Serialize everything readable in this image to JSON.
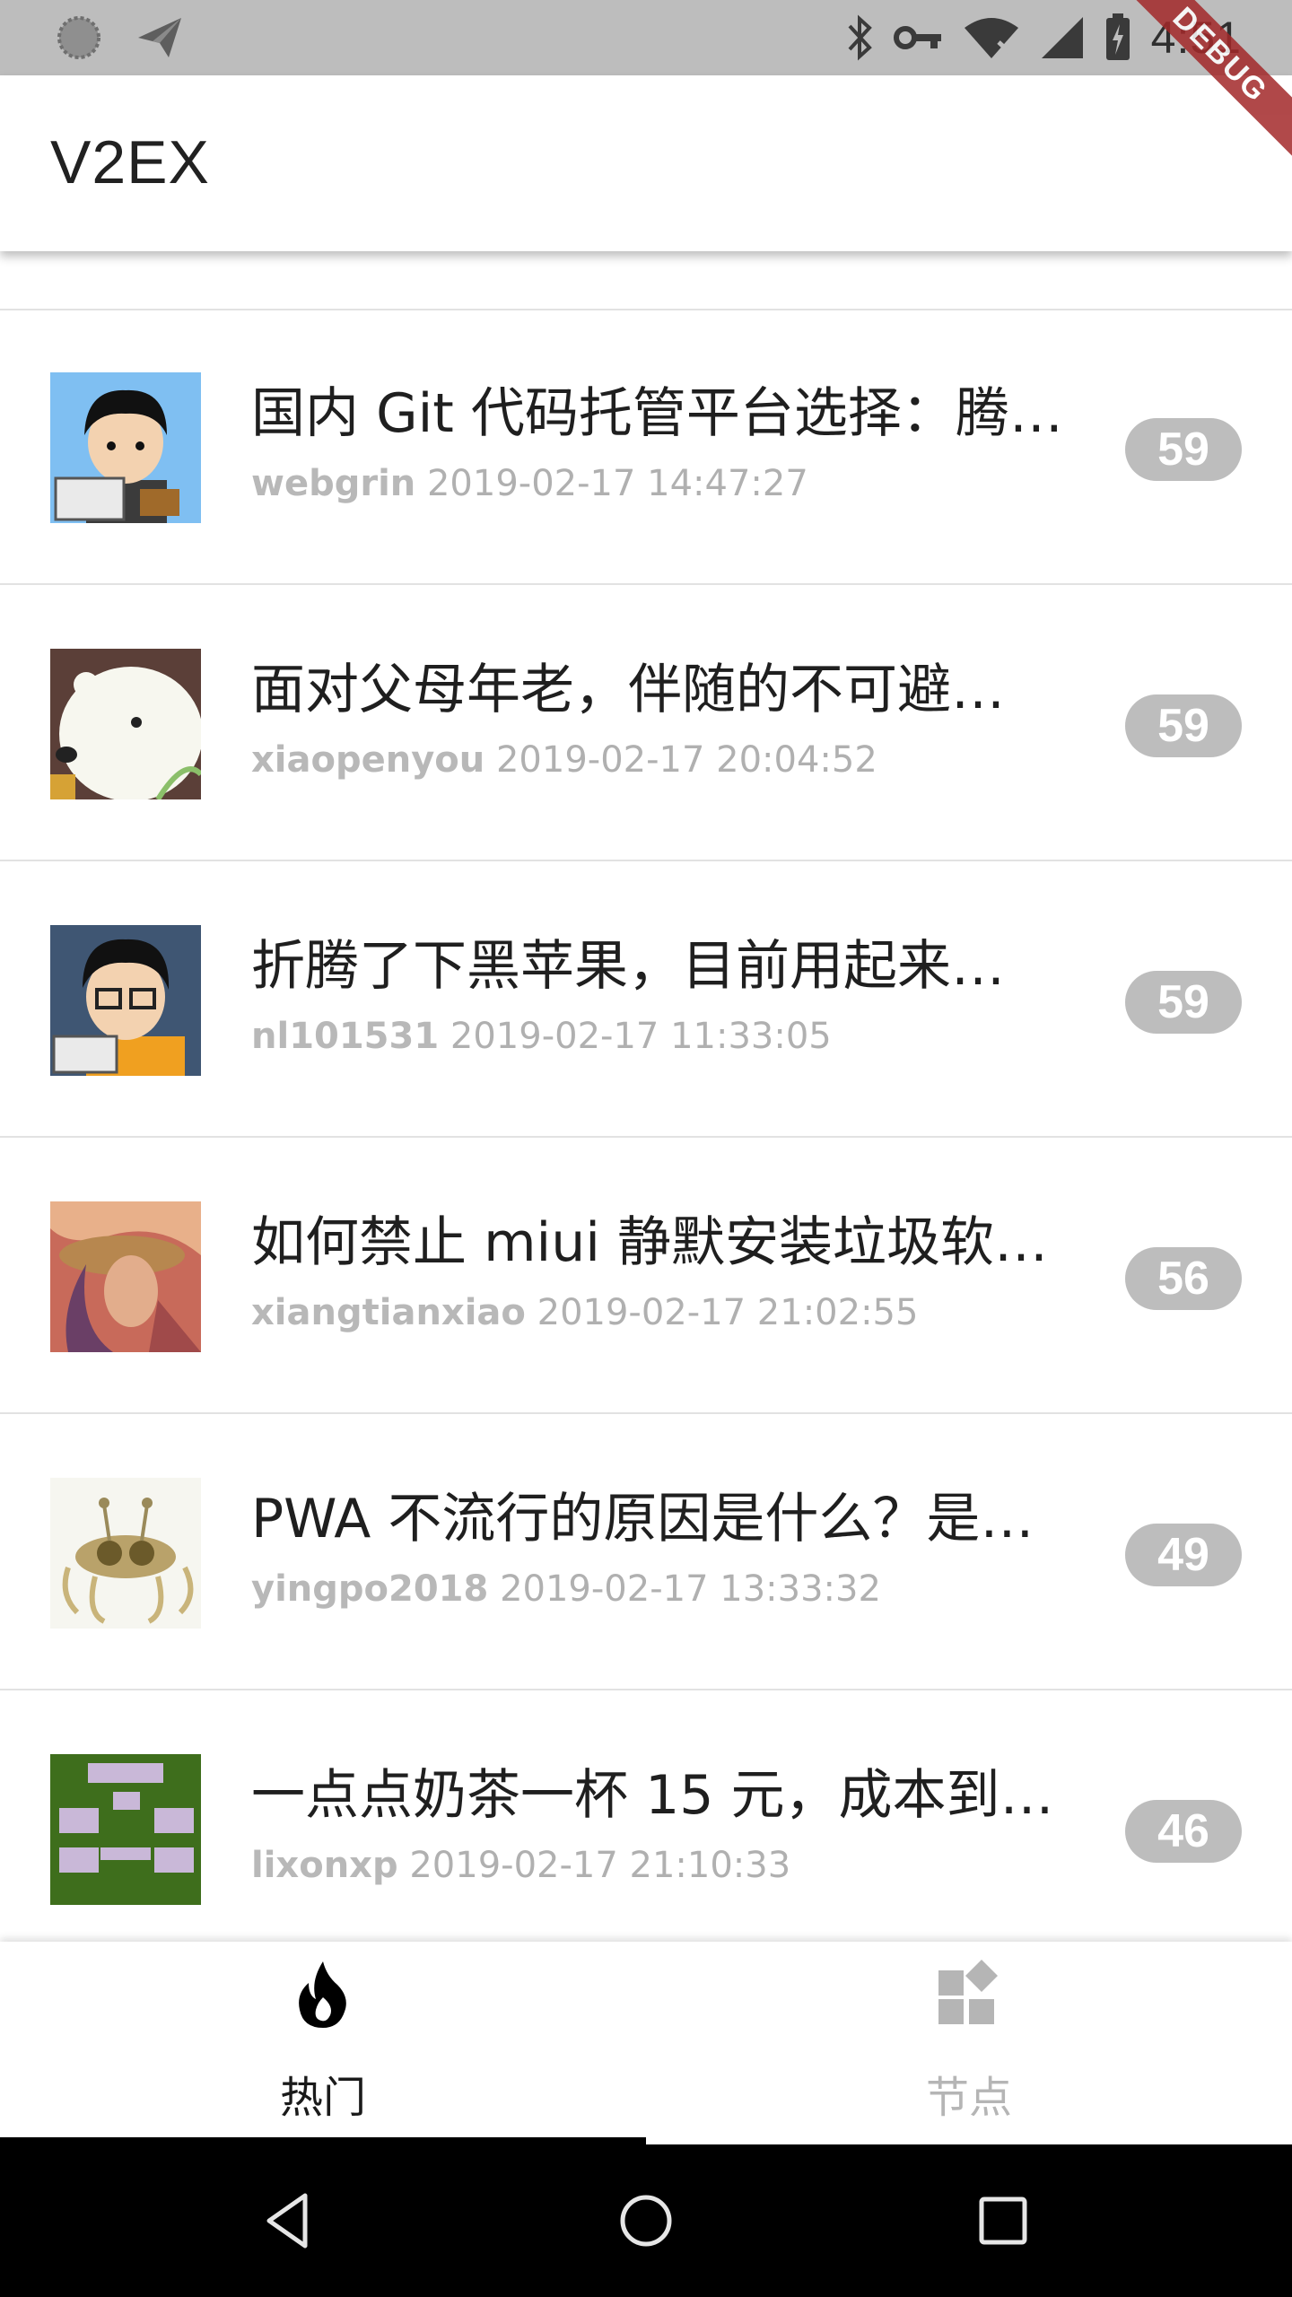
{
  "status_bar": {
    "time": "4:51",
    "icons": [
      "loading-circle-icon",
      "send-icon",
      "bluetooth-icon",
      "vpn-key-icon",
      "wifi-icon",
      "signal-icon",
      "battery-icon"
    ],
    "debug_label": "DEBUG"
  },
  "app_bar": {
    "title": "V2EX"
  },
  "topics": [
    {
      "title": "国内 Git 代码托管平台选择：腾…",
      "author": "webgrin",
      "time": "2019-02-17 14:47:27",
      "replies": "59"
    },
    {
      "title": "面对父母年老，伴随的不可避…",
      "author": "xiaopenyou",
      "time": "2019-02-17 20:04:52",
      "replies": "59"
    },
    {
      "title": "折腾了下黑苹果，目前用起来…",
      "author": "nl101531",
      "time": "2019-02-17 11:33:05",
      "replies": "59"
    },
    {
      "title": "如何禁止 miui 静默安装垃圾软…",
      "author": "xiangtianxiao",
      "time": "2019-02-17 21:02:55",
      "replies": "56"
    },
    {
      "title": "PWA 不流行的原因是什么？是…",
      "author": "yingpo2018",
      "time": "2019-02-17 13:33:32",
      "replies": "49"
    },
    {
      "title": "一点点奶茶一杯 15 元，成本到…",
      "author": "lixonxp",
      "time": "2019-02-17 21:10:33",
      "replies": "46"
    }
  ],
  "bottom_nav": {
    "tabs": [
      {
        "label": "热门",
        "icon": "fire-icon",
        "active": true
      },
      {
        "label": "节点",
        "icon": "widgets-icon",
        "active": false
      }
    ]
  },
  "colors": {
    "badge": "#bdbdbd",
    "meta_text": "#b0b0b0",
    "active_tab": "#000000",
    "inactive_tab": "#b5b5b5"
  }
}
